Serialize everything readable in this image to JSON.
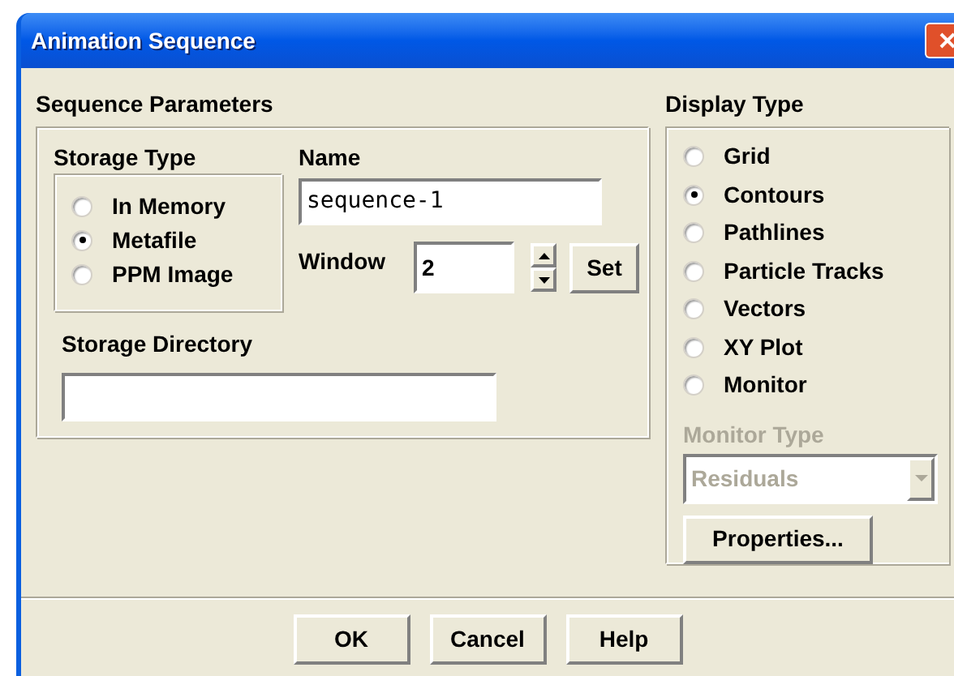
{
  "window": {
    "title": "Animation Sequence"
  },
  "sequence_parameters": {
    "title": "Sequence Parameters",
    "storage_type": {
      "title": "Storage Type",
      "options": [
        {
          "label": "In Memory",
          "selected": false
        },
        {
          "label": "Metafile",
          "selected": true
        },
        {
          "label": "PPM Image",
          "selected": false
        }
      ]
    },
    "name": {
      "label": "Name",
      "value": "sequence-1"
    },
    "window_field": {
      "label": "Window",
      "value": "2"
    },
    "set_button": "Set",
    "storage_directory": {
      "label": "Storage Directory"
    }
  },
  "display_type": {
    "title": "Display Type",
    "options": [
      {
        "label": "Grid",
        "selected": false
      },
      {
        "label": "Contours",
        "selected": true
      },
      {
        "label": "Pathlines",
        "selected": false
      },
      {
        "label": "Particle Tracks",
        "selected": false
      },
      {
        "label": "Vectors",
        "selected": false
      },
      {
        "label": "XY Plot",
        "selected": false
      },
      {
        "label": "Monitor",
        "selected": false
      }
    ],
    "monitor_type": {
      "label": "Monitor Type",
      "value": "Residuals",
      "disabled": true
    },
    "properties_button": "Properties..."
  },
  "buttons": [
    "OK",
    "Cancel",
    "Help"
  ]
}
